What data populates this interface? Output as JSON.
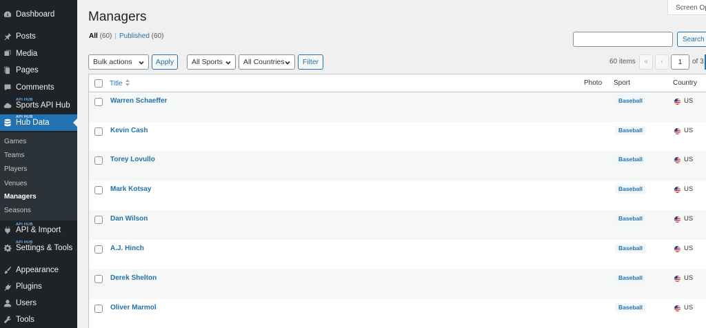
{
  "sidebar": {
    "items": [
      {
        "label": "Dashboard",
        "icon": "dashboard-icon",
        "tag": ""
      },
      {
        "label": "Posts",
        "icon": "pushpin-icon",
        "tag": ""
      },
      {
        "label": "Media",
        "icon": "media-icon",
        "tag": ""
      },
      {
        "label": "Pages",
        "icon": "pages-icon",
        "tag": ""
      },
      {
        "label": "Comments",
        "icon": "comments-icon",
        "tag": ""
      },
      {
        "label": "Sports API Hub",
        "icon": "cloud-icon",
        "tag": "API HUB"
      },
      {
        "label": "Hub Data",
        "icon": "database-icon",
        "tag": "API HUB"
      },
      {
        "label": "API & Import",
        "icon": "plug-icon",
        "tag": "API HUB"
      },
      {
        "label": "Settings & Tools",
        "icon": "gear-icon",
        "tag": "API HUB"
      },
      {
        "label": "Appearance",
        "icon": "brush-icon",
        "tag": ""
      },
      {
        "label": "Plugins",
        "icon": "plugin-icon",
        "tag": ""
      },
      {
        "label": "Users",
        "icon": "users-icon",
        "tag": ""
      },
      {
        "label": "Tools",
        "icon": "wrench-icon",
        "tag": ""
      }
    ],
    "submenu": [
      "Games",
      "Teams",
      "Players",
      "Venues",
      "Managers",
      "Seasons"
    ]
  },
  "header": {
    "screen_options": "Screen Op",
    "title": "Managers"
  },
  "filters": {
    "all_label": "All",
    "all_count": "(60)",
    "separator": "|",
    "published_label": "Published",
    "published_count": "(60)"
  },
  "search": {
    "placeholder": "",
    "button_label": "Search M"
  },
  "toolbar": {
    "bulk_actions": "Bulk actions",
    "apply": "Apply",
    "sports": "All Sports",
    "countries": "All Countries",
    "filter": "Filter",
    "items_count": "60 items",
    "first_page": "«",
    "prev_page": "‹",
    "current_page": "1",
    "of_pages": "of 3"
  },
  "table": {
    "columns": {
      "title": "Title",
      "photo": "Photo",
      "sport": "Sport",
      "country": "Country"
    },
    "rows": [
      {
        "title": "Warren Schaeffer",
        "sport": "Baseball",
        "country": "US"
      },
      {
        "title": "Kevin Cash",
        "sport": "Baseball",
        "country": "US"
      },
      {
        "title": "Torey Lovullo",
        "sport": "Baseball",
        "country": "US"
      },
      {
        "title": "Mark Kotsay",
        "sport": "Baseball",
        "country": "US"
      },
      {
        "title": "Dan Wilson",
        "sport": "Baseball",
        "country": "US"
      },
      {
        "title": "A.J. Hinch",
        "sport": "Baseball",
        "country": "US"
      },
      {
        "title": "Derek Shelton",
        "sport": "Baseball",
        "country": "US"
      },
      {
        "title": "Oliver Marmol",
        "sport": "Baseball",
        "country": "US"
      }
    ]
  },
  "colors": {
    "sidebar_bg": "#1d2327",
    "accent": "#2271b1",
    "page_bg": "#f0f0f1"
  }
}
